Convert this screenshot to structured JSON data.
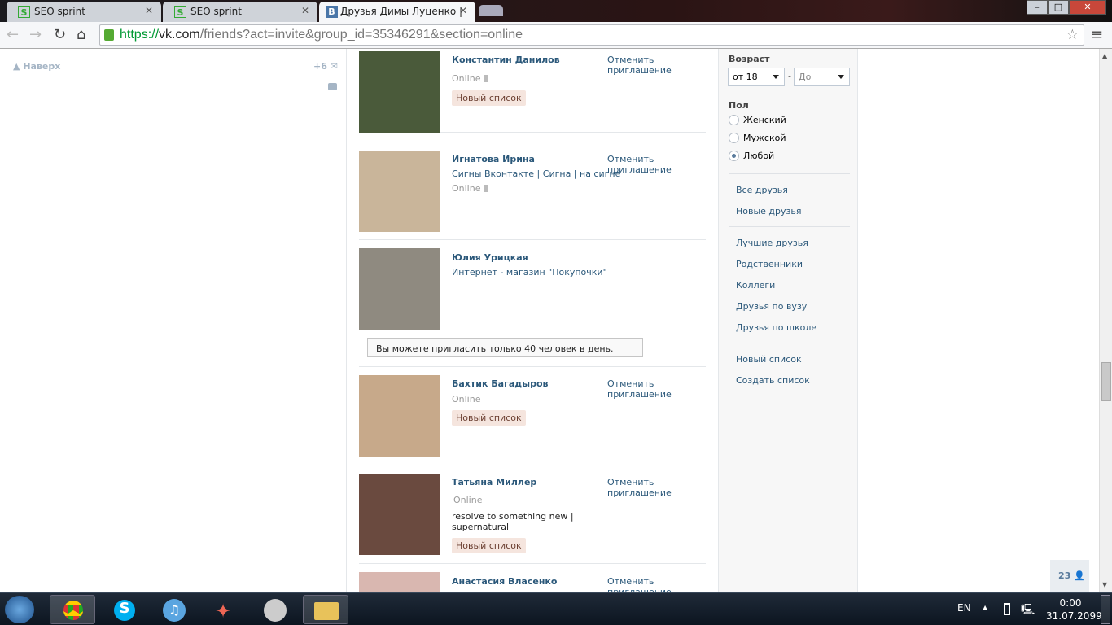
{
  "browser": {
    "tabs": [
      {
        "label": "SEO sprint",
        "icon": "seo-sprint-icon"
      },
      {
        "label": "SEO sprint",
        "icon": "seo-sprint-icon"
      },
      {
        "label": "Друзья Димы Луценко |",
        "icon": "vk-icon"
      }
    ],
    "url_scheme": "https://",
    "url_host": "vk.com",
    "url_path": "/friends?act=invite&group_id=35346291&section=online"
  },
  "left": {
    "top_link": "Наверх",
    "messages_count": "+6"
  },
  "friends": [
    {
      "name": "Константин Данилов",
      "status": "Online",
      "tag": "Новый список",
      "action": "Отменить приглашение",
      "photo": "#4a5a3a"
    },
    {
      "name": "Игнатова Ирина",
      "subtitle": "Сигны Вконтакте | Сигна | на сигне",
      "status": "Online",
      "action": "Отменить приглашение",
      "photo": "#c9b59a"
    },
    {
      "name": "Юлия Урицкая",
      "subtitle": "Интернет - магазин \"Покупочки\"",
      "notice": "Вы можете пригласить только 40 человек в день.",
      "photo": "#8f8a80"
    },
    {
      "name": "Бахтик Багадыров",
      "status": "Online",
      "tag": "Новый список",
      "action": "Отменить приглашение",
      "photo": "#c7a98a"
    },
    {
      "name": "Татьяна Миллер",
      "status": "Online",
      "subtitle": "resolve to something new | supernatural",
      "tag": "Новый список",
      "action": "Отменить приглашение",
      "photo": "#6a4a3f"
    },
    {
      "name": "Анастасия Власенко",
      "action": "Отменить приглашение",
      "photo": "#d9b7b0"
    }
  ],
  "filters": {
    "age_label": "Возраст",
    "age_from": "от 18",
    "age_to": "До",
    "gender_label": "Пол",
    "genders": [
      "Женский",
      "Мужской",
      "Любой"
    ],
    "gender_selected": "Любой",
    "links1": [
      "Все друзья",
      "Новые друзья"
    ],
    "links2": [
      "Лучшие друзья",
      "Родственники",
      "Коллеги",
      "Друзья по вузу",
      "Друзья по школе"
    ],
    "links3": [
      "Новый список",
      "Создать список"
    ]
  },
  "online_counter": "23",
  "taskbar": {
    "lang": "EN",
    "time": "0:00",
    "date": "31.07.2099"
  }
}
